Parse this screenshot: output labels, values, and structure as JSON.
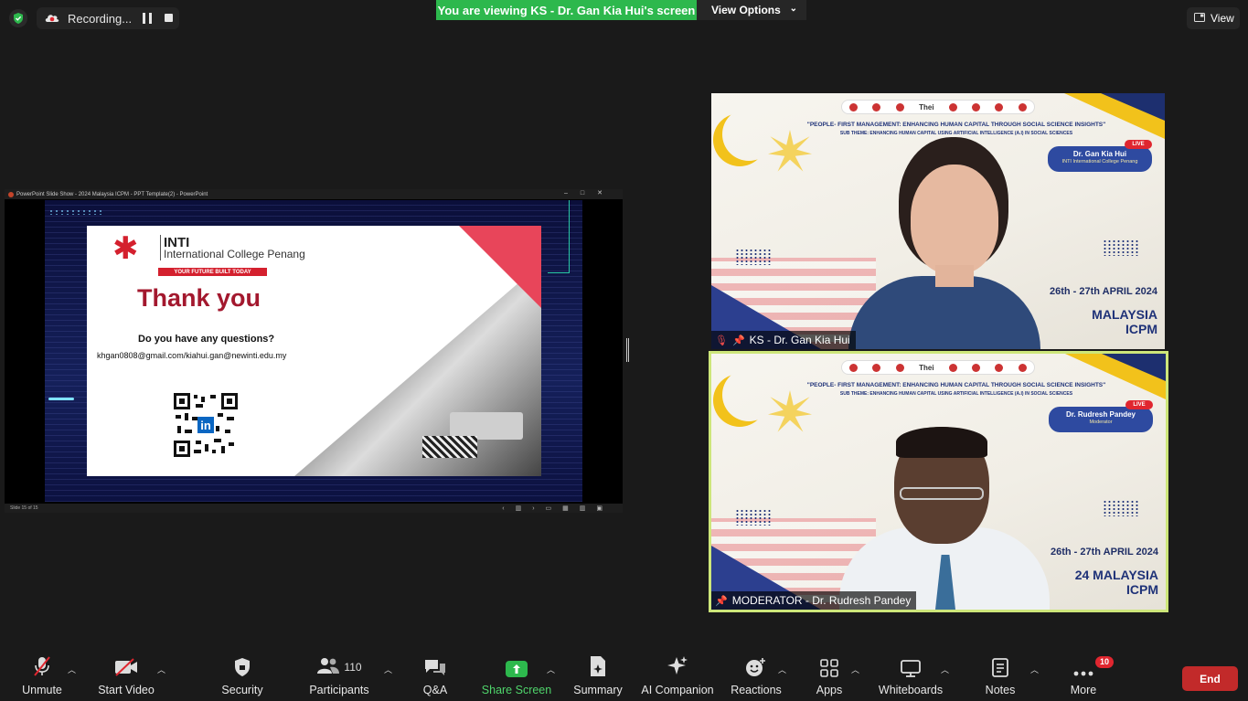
{
  "top": {
    "recording_label": "Recording...",
    "viewing_banner": "You are viewing KS - Dr. Gan Kia Hui's screen",
    "view_options_label": "View Options",
    "view_label": "View"
  },
  "shared_screen": {
    "window_title": "PowerPoint Slide Show - 2024 Malaysia ICPM - PPT Template(2) - PowerPoint",
    "status_text": "Slide 15 of 15",
    "slide": {
      "brand_name": "INTI",
      "college_name": "International College Penang",
      "tagline": "YOUR FUTURE BUILT TODAY",
      "heading": "Thank you",
      "question": "Do you have any questions?",
      "contact": "khgan0808@gmail.com/kiahui.gan@newinti.edu.my"
    }
  },
  "participants": [
    {
      "display_name": "KS - Dr. Gan Kia Hui",
      "card_name": "Dr. Gan Kia Hui",
      "card_subtitle": "INTI International College Penang",
      "live_label": "LIVE",
      "theme": "\"PEOPLE- FIRST MANAGEMENT: ENHANCING HUMAN CAPITAL THROUGH SOCIAL SCIENCE INSIGHTS\"",
      "sub_theme": "SUB THEME: ENHANCING HUMAN CAPITAL USING ARTIFICIAL INTELLIGENCE (A.I) IN SOCIAL SCIENCES",
      "dates": "26th - 27th APRIL 2024",
      "event_line1": "MALAYSIA",
      "event_line2": "ICPM",
      "logo_text": "Thei",
      "muted": true
    },
    {
      "display_name": "MODERATOR - Dr. Rudresh Pandey",
      "card_name": "Dr. Rudresh Pandey",
      "card_subtitle": "Moderator",
      "live_label": "LIVE",
      "theme": "\"PEOPLE- FIRST MANAGEMENT: ENHANCING HUMAN CAPITAL THROUGH SOCIAL SCIENCE INSIGHTS\"",
      "sub_theme": "SUB THEME: ENHANCING HUMAN CAPITAL USING ARTIFICIAL INTELLIGENCE (A.I) IN SOCIAL SCIENCES",
      "dates": "26th - 27th APRIL 2024",
      "event_line1": "24 MALAYSIA",
      "event_line2": "ICPM",
      "logo_text": "Thei",
      "muted": false,
      "active_speaker": true
    }
  ],
  "toolbar": {
    "unmute": "Unmute",
    "start_video": "Start Video",
    "security": "Security",
    "participants": "Participants",
    "participants_count": "110",
    "qa": "Q&A",
    "share_screen": "Share Screen",
    "summary": "Summary",
    "ai_companion": "AI Companion",
    "reactions": "Reactions",
    "apps": "Apps",
    "whiteboards": "Whiteboards",
    "notes": "Notes",
    "more": "More",
    "more_badge": "10",
    "end": "End"
  },
  "colors": {
    "viewing_banner": "#2db84d",
    "end_button": "#c22a2a",
    "active_speaker_border": "#cde67a",
    "slide_heading": "#a3182e"
  }
}
